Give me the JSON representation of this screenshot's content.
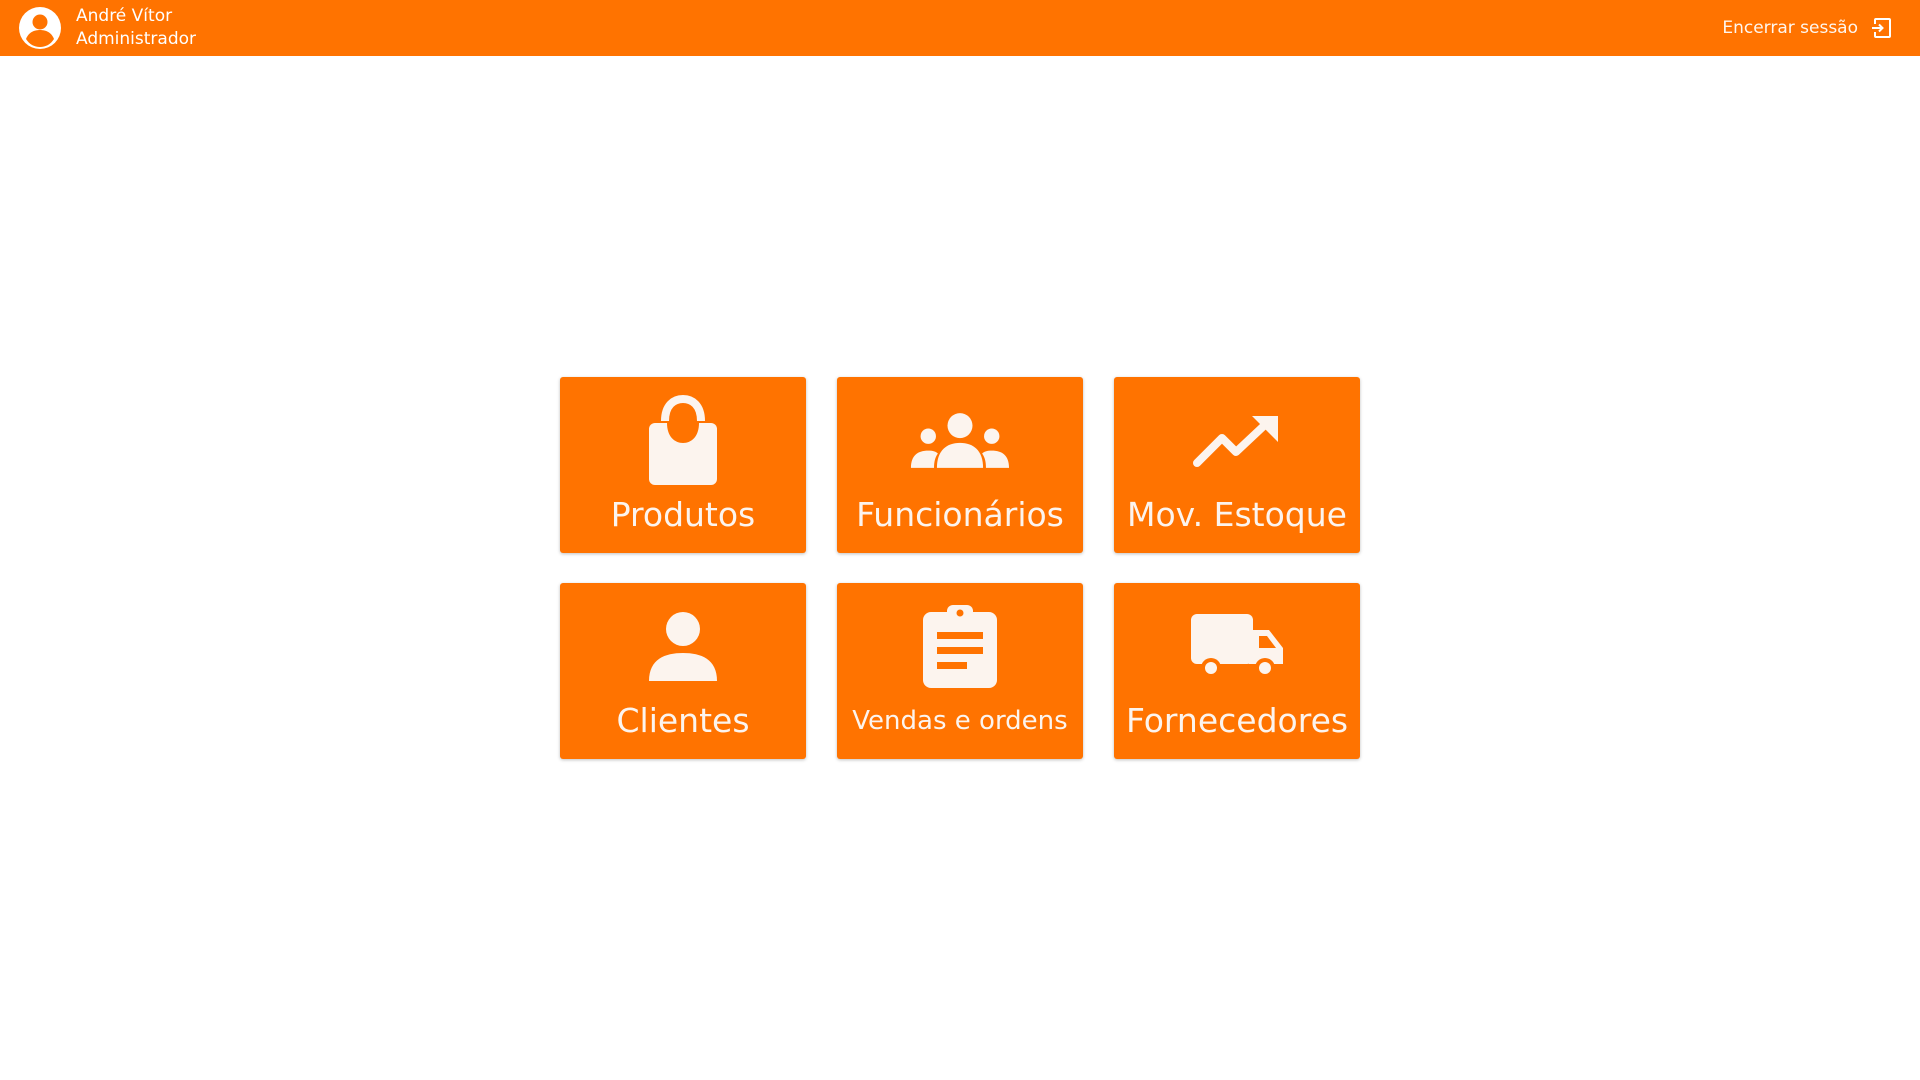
{
  "header": {
    "user_name": "André Vítor",
    "user_role": "Administrador",
    "logout_label": "Encerrar sessão",
    "avatar_icon": "account-circle-icon",
    "logout_icon": "logout-icon"
  },
  "colors": {
    "accent": "#ff7300",
    "tile_text": "#fcf4ee",
    "background": "#ffffff"
  },
  "tiles": [
    {
      "label": "Produtos",
      "icon": "shopping-bag-icon"
    },
    {
      "label": "Funcionários",
      "icon": "group-icon"
    },
    {
      "label": "Mov. Estoque",
      "icon": "trending-up-icon"
    },
    {
      "label": "Clientes",
      "icon": "person-icon"
    },
    {
      "label": "Vendas e ordens",
      "icon": "clipboard-icon"
    },
    {
      "label": "Fornecedores",
      "icon": "truck-icon"
    }
  ]
}
